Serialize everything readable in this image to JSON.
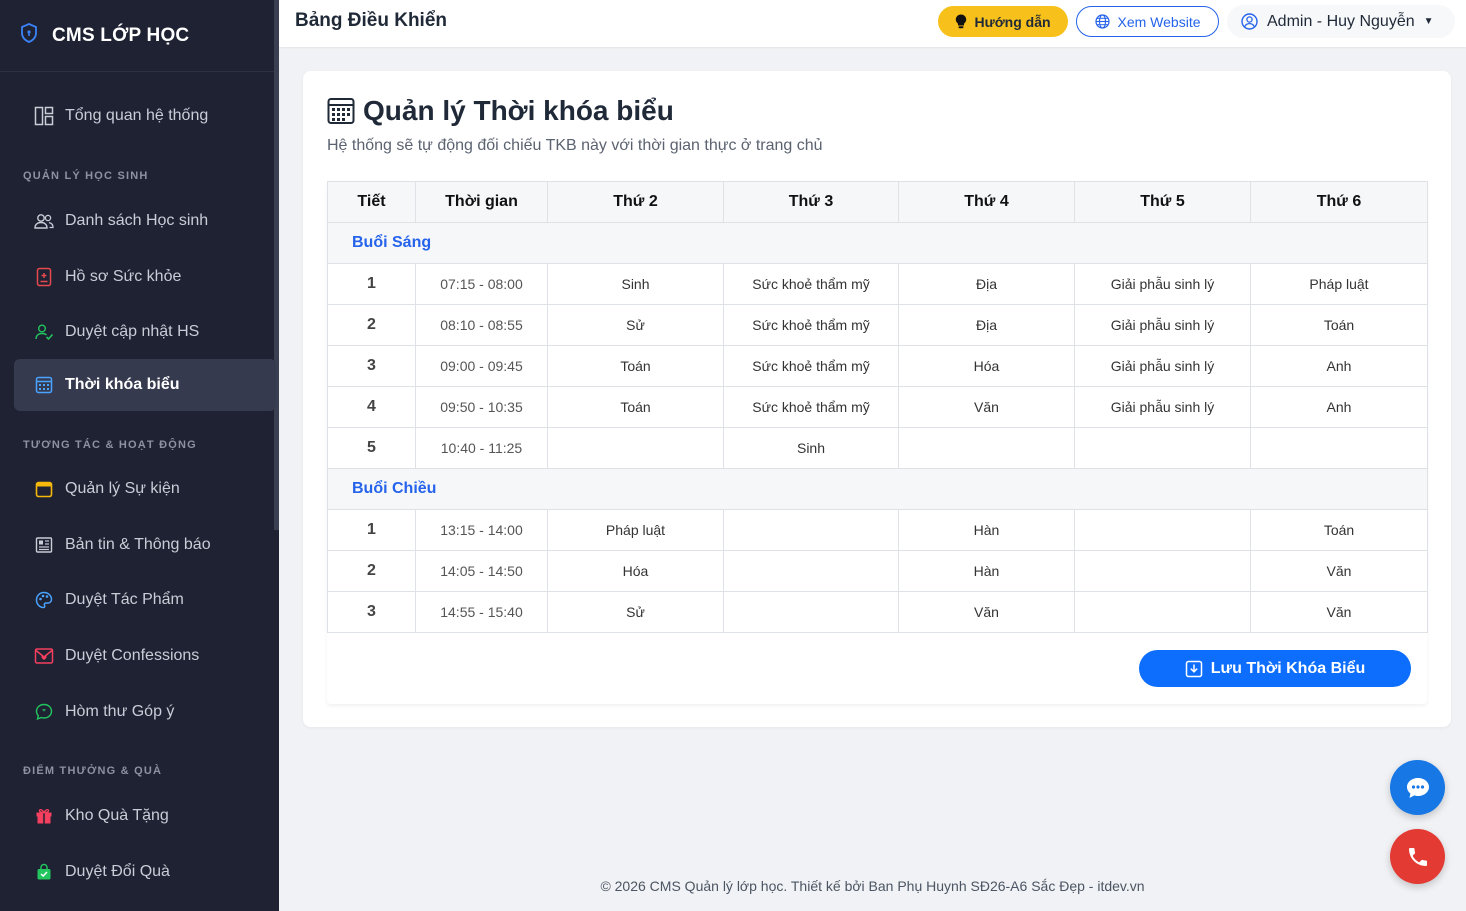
{
  "brand": {
    "name": "CMS LỚP HỌC",
    "icon": "shield-icon"
  },
  "sidebar": {
    "items": [
      {
        "key": "overview",
        "label": "Tổng quan hệ thống",
        "icon": "dashboard-icon"
      },
      {
        "key": "students",
        "label": "Danh sách Học sinh",
        "icon": "users-icon"
      },
      {
        "key": "health",
        "label": "Hồ sơ Sức khỏe",
        "icon": "medical-file-icon"
      },
      {
        "key": "approve-updates",
        "label": "Duyệt cập nhật HS",
        "icon": "user-check-icon"
      },
      {
        "key": "timetable",
        "label": "Thời khóa biểu",
        "icon": "calendar-grid-icon",
        "active": true
      },
      {
        "key": "events",
        "label": "Quản lý Sự kiện",
        "icon": "calendar-icon"
      },
      {
        "key": "news",
        "label": "Bản tin & Thông báo",
        "icon": "newspaper-icon"
      },
      {
        "key": "artworks",
        "label": "Duyệt Tác Phẩm",
        "icon": "palette-icon"
      },
      {
        "key": "confessions",
        "label": "Duyệt Confessions",
        "icon": "envelope-heart-icon"
      },
      {
        "key": "feedback",
        "label": "Hòm thư Góp ý",
        "icon": "chat-quote-icon"
      },
      {
        "key": "gifts",
        "label": "Kho Quà Tặng",
        "icon": "gift-icon"
      },
      {
        "key": "redeem",
        "label": "Duyệt Đổi Quà",
        "icon": "bag-check-icon"
      }
    ],
    "sections": {
      "students": "QUẢN LÝ HỌC SINH",
      "activities": "TƯƠNG TÁC & HOẠT ĐỘNG",
      "rewards": "ĐIỂM THƯỞNG & QUÀ"
    }
  },
  "header": {
    "title": "Bảng Điều Khiển",
    "guide_label": "Hướng dẫn",
    "website_label": "Xem Website",
    "user_label": "Admin - Huy Nguyễn"
  },
  "card": {
    "title": "Quản lý Thời khóa biểu",
    "subtitle": "Hệ thống sẽ tự động đối chiếu TKB này với thời gian thực ở trang chủ",
    "save_label": "Lưu Thời Khóa Biểu"
  },
  "table": {
    "headers": [
      "Tiết",
      "Thời gian",
      "Thứ 2",
      "Thứ 3",
      "Thứ 4",
      "Thứ 5",
      "Thứ 6"
    ],
    "morning_label": "Buổi Sáng",
    "afternoon_label": "Buổi Chiều",
    "morning": [
      [
        "1",
        "07:15 - 08:00",
        "Sinh",
        "Sức khoẻ thẩm mỹ",
        "Địa",
        "Giải phẫu sinh lý",
        "Pháp luật"
      ],
      [
        "2",
        "08:10 - 08:55",
        "Sử",
        "Sức khoẻ thẩm mỹ",
        "Địa",
        "Giải phẫu sinh lý",
        "Toán"
      ],
      [
        "3",
        "09:00 - 09:45",
        "Toán",
        "Sức khoẻ thẩm mỹ",
        "Hóa",
        "Giải phẫu sinh lý",
        "Anh"
      ],
      [
        "4",
        "09:50 - 10:35",
        "Toán",
        "Sức khoẻ thẩm mỹ",
        "Văn",
        "Giải phẫu sinh lý",
        "Anh"
      ],
      [
        "5",
        "10:40 - 11:25",
        "",
        "Sinh",
        "",
        "",
        ""
      ]
    ],
    "afternoon": [
      [
        "1",
        "13:15 - 14:00",
        "Pháp luật",
        "",
        "Hàn",
        "",
        "Toán"
      ],
      [
        "2",
        "14:05 - 14:50",
        "Hóa",
        "",
        "Hàn",
        "",
        "Văn"
      ],
      [
        "3",
        "14:55 - 15:40",
        "Sử",
        "",
        "Văn",
        "",
        "Văn"
      ]
    ]
  },
  "footer": {
    "text": "© 2026 CMS Quản lý lớp học. Thiết kế bởi Ban Phụ Huynh SĐ26-A6 Sắc Đẹp - itdev.vn"
  },
  "colors": {
    "sidebar_bg": "#1f2232",
    "accent": "#2563eb",
    "warning": "#f8c01a",
    "danger": "#e33a33"
  }
}
